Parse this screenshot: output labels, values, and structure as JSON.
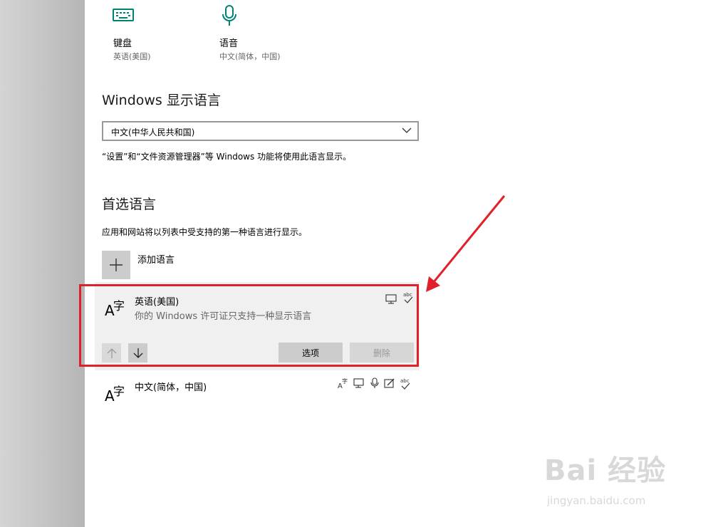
{
  "top_tiles": [
    {
      "icon": "keyboard-icon",
      "label": "键盘",
      "sub": "英语(美国)"
    },
    {
      "icon": "microphone-icon",
      "label": "语音",
      "sub": "中文(简体，中国)"
    }
  ],
  "display_language": {
    "title": "Windows 显示语言",
    "selected": "中文(中华人民共和国)",
    "note": "“设置”和“文件资源管理器”等 Windows 功能将使用此语言显示。"
  },
  "preferred": {
    "title": "首选语言",
    "description": "应用和网站将以列表中受支持的第一种语言进行显示。",
    "add_label": "添加语言",
    "languages": [
      {
        "name": "英语(美国)",
        "sub": "你的 Windows 许可证只支持一种显示语言",
        "features": [
          "display-icon",
          "spellcheck-icon"
        ]
      },
      {
        "name": "中文(简体，中国)",
        "sub": "",
        "features": [
          "language-pack-icon",
          "display-icon",
          "microphone-icon",
          "handwriting-icon",
          "spellcheck-icon"
        ]
      }
    ],
    "options_label": "选项",
    "remove_label": "删除"
  },
  "glyph": {
    "a": "A",
    "zi": "字"
  },
  "watermark": {
    "main": "Bai 经验",
    "sub": "jingyan.baidu.com"
  },
  "colors": {
    "accent": "#008272",
    "highlight_box": "#e0202a"
  }
}
